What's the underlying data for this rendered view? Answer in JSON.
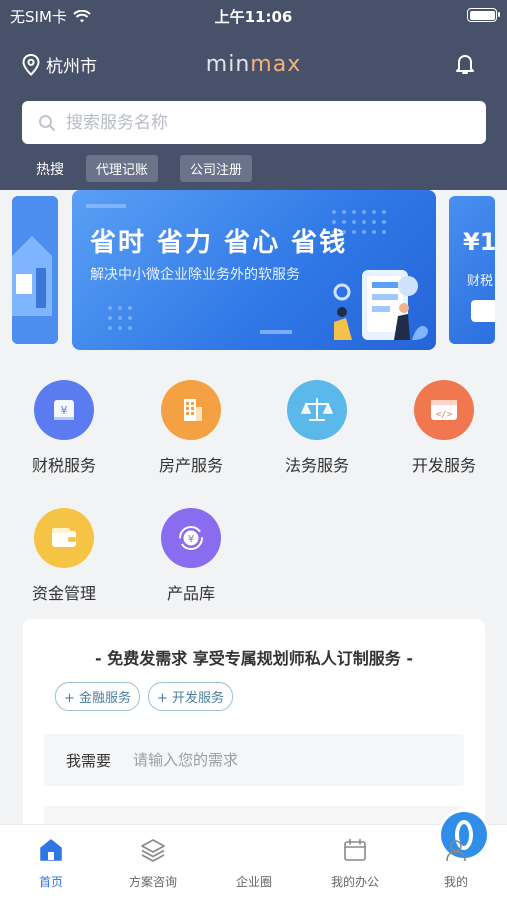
{
  "status_bar": {
    "carrier": "无SIM卡",
    "time": "上午11:06"
  },
  "header": {
    "city": "杭州市",
    "logo_left": "min",
    "logo_right": "max"
  },
  "search": {
    "placeholder": "搜索服务名称"
  },
  "hot_search": {
    "label": "热搜",
    "chips": [
      "代理记账",
      "公司注册"
    ]
  },
  "banner": {
    "title": "省时 省力 省心 省钱",
    "subtitle": "解决中小微企业除业务外的软服务",
    "right_card_title": "¥1",
    "right_card_sub": "财税"
  },
  "services": [
    {
      "label": "财税服务",
      "icon": "tax-icon",
      "color": "#5b7cf0"
    },
    {
      "label": "房产服务",
      "icon": "building-icon",
      "color": "#f3a142"
    },
    {
      "label": "法务服务",
      "icon": "scale-icon",
      "color": "#5ab8ea"
    },
    {
      "label": "开发服务",
      "icon": "code-icon",
      "color": "#f0774f"
    },
    {
      "label": "资金管理",
      "icon": "wallet-icon",
      "color": "#f6c445"
    },
    {
      "label": "产品库",
      "icon": "yuan-cycle-icon",
      "color": "#8a6cf0"
    }
  ],
  "request": {
    "title": "- 免费发需求 享受专属规划师私人订制服务 -",
    "tags": [
      "+ 金融服务",
      "+ 开发服务"
    ],
    "need_label": "我需要",
    "need_placeholder": "请输入您的需求"
  },
  "tabs": [
    {
      "label": "首页",
      "active": true
    },
    {
      "label": "方案咨询",
      "active": false
    },
    {
      "label": "企业圈",
      "active": false
    },
    {
      "label": "我的办公",
      "active": false
    },
    {
      "label": "我的",
      "active": false
    }
  ],
  "colors": {
    "header_bg": "#47526a",
    "accent": "#2f77e6"
  }
}
